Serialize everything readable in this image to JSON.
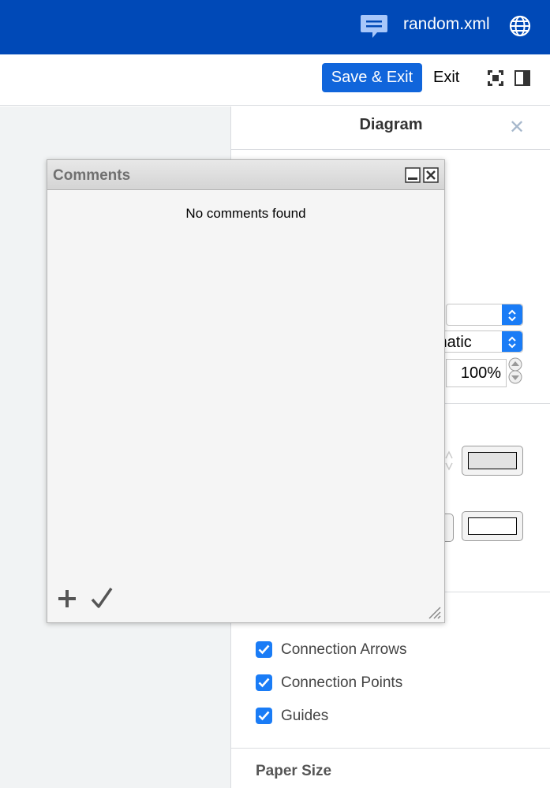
{
  "header": {
    "filename": "random.xml",
    "background": "#0049b7"
  },
  "toolbar": {
    "save_label": "Save & Exit",
    "exit_label": "Exit",
    "accent": "#1065db"
  },
  "panel": {
    "title": "Diagram",
    "select_partial_text": "matic",
    "zoom_value": "100%",
    "checkboxes": [
      {
        "label": "Connection Arrows",
        "checked": true
      },
      {
        "label": "Connection Points",
        "checked": true
      },
      {
        "label": "Guides",
        "checked": true
      }
    ],
    "paper_size_heading": "Paper Size"
  },
  "comments_dialog": {
    "title": "Comments",
    "empty_message": "No comments found"
  },
  "icons": [
    "comment-icon",
    "globe-icon",
    "fit-page-icon",
    "toggle-panel-icon",
    "close-icon",
    "minimize-icon",
    "add-icon",
    "checkmark-icon",
    "resize-grip-icon"
  ]
}
